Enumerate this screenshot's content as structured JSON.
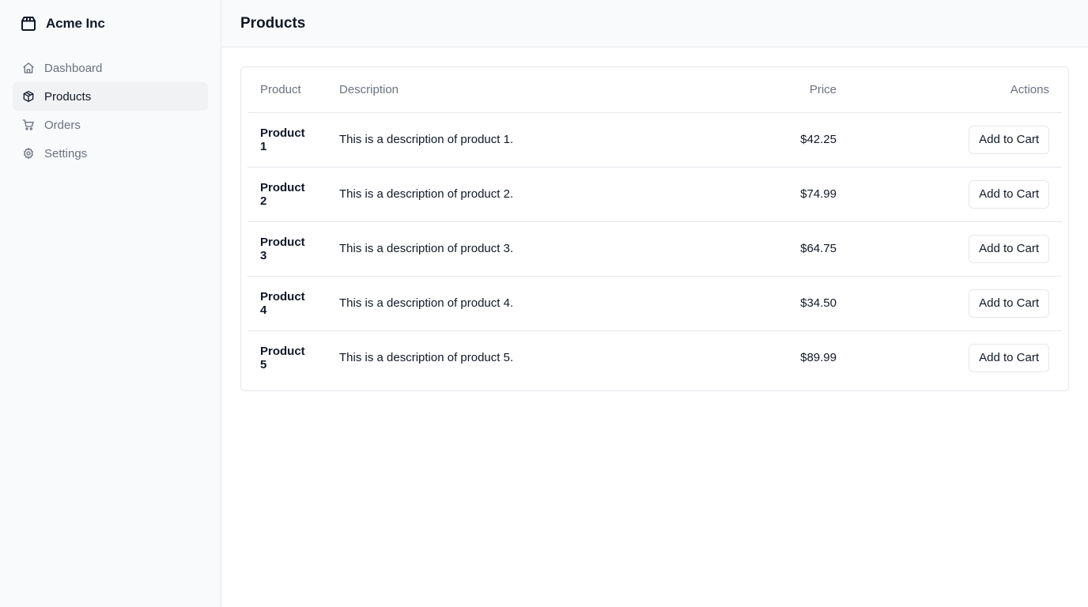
{
  "brand": {
    "name": "Acme Inc",
    "icon": "package-icon"
  },
  "sidebar": {
    "items": [
      {
        "label": "Dashboard",
        "icon": "home-icon",
        "active": false
      },
      {
        "label": "Products",
        "icon": "box-icon",
        "active": true
      },
      {
        "label": "Orders",
        "icon": "cart-icon",
        "active": false
      },
      {
        "label": "Settings",
        "icon": "gear-icon",
        "active": false
      }
    ]
  },
  "header": {
    "title": "Products"
  },
  "table": {
    "columns": [
      "Product",
      "Description",
      "Price",
      "Actions"
    ],
    "rows": [
      {
        "name": "Product 1",
        "description": "This is a description of product 1.",
        "price": "$42.25",
        "action": "Add to Cart"
      },
      {
        "name": "Product 2",
        "description": "This is a description of product 2.",
        "price": "$74.99",
        "action": "Add to Cart"
      },
      {
        "name": "Product 3",
        "description": "This is a description of product 3.",
        "price": "$64.75",
        "action": "Add to Cart"
      },
      {
        "name": "Product 4",
        "description": "This is a description of product 4.",
        "price": "$34.50",
        "action": "Add to Cart"
      },
      {
        "name": "Product 5",
        "description": "This is a description of product 5.",
        "price": "$89.99",
        "action": "Add to Cart"
      }
    ]
  },
  "colors": {
    "sidebar_bg": "#f9fafb",
    "active_item_bg": "#f1f2f4",
    "border": "#e5e7eb",
    "muted_text": "#6b7280",
    "text": "#111827"
  }
}
